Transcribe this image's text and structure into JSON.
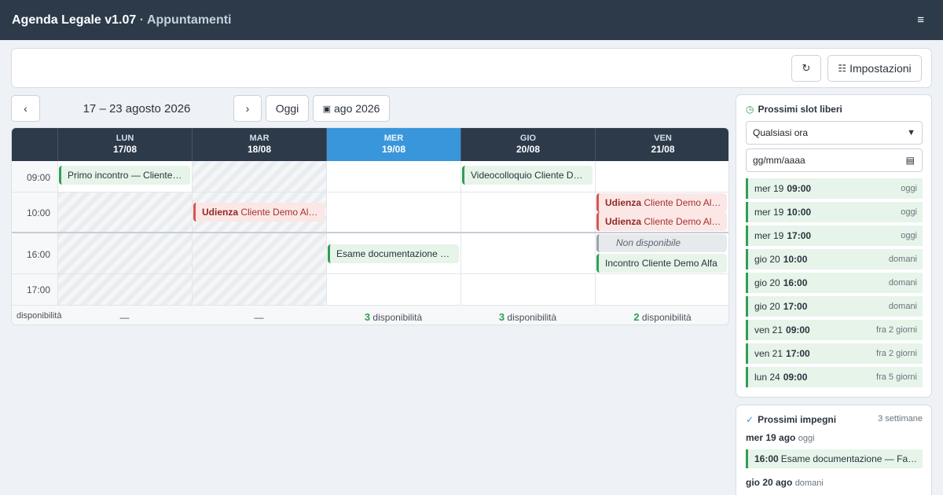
{
  "header": {
    "app_title": "Agenda Legale v1.07",
    "separator": "·",
    "section": "Appuntamenti",
    "menu_icon": "≡"
  },
  "toolbar": {
    "refresh_icon": "↻",
    "settings_icon": "☷",
    "settings_label": "Impostazioni"
  },
  "week_nav": {
    "prev": "‹",
    "range": "17 – 23 agosto 2026",
    "next": "›",
    "today": "Oggi",
    "month_icon": "▣",
    "month": "ago 2026"
  },
  "calendar": {
    "days": [
      {
        "name": "LUN",
        "date": "17/08"
      },
      {
        "name": "MAR",
        "date": "18/08"
      },
      {
        "name": "MER",
        "date": "19/08"
      },
      {
        "name": "GIO",
        "date": "20/08"
      },
      {
        "name": "VEN",
        "date": "21/08"
      }
    ],
    "today_index": 2,
    "times": [
      "09:00",
      "10:00",
      "16:00",
      "17:00"
    ],
    "events": [
      {
        "text": "Primo incontro — Cliente…",
        "type": "green"
      },
      {
        "text": "Videocolloquio Cliente D…",
        "type": "green"
      },
      {
        "strong": "Udienza",
        "text": " Cliente Demo Al…",
        "type": "red"
      },
      {
        "strong": "Udienza",
        "text": " Cliente Demo Al…",
        "type": "red"
      },
      {
        "strong": "Udienza",
        "text": " Cliente Demo Al…",
        "type": "red"
      },
      {
        "text": "Non disponibile",
        "type": "gray"
      },
      {
        "text": "Esame documentazione …",
        "type": "green"
      },
      {
        "text": "Incontro Cliente Demo Alfa",
        "type": "green"
      }
    ],
    "availability_label": "disponibilità",
    "availability": [
      {
        "count": "",
        "text": "—"
      },
      {
        "count": "",
        "text": "—"
      },
      {
        "count": "3",
        "text": " disponibilità"
      },
      {
        "count": "3",
        "text": " disponibilità"
      },
      {
        "count": "2",
        "text": " disponibilità"
      }
    ]
  },
  "free_slots": {
    "icon": "◷",
    "title": "Prossimi slot liberi",
    "select_value": "Qualsiasi ora",
    "date_placeholder": "gg/mm/aaaa",
    "slots": [
      {
        "day": "mer 19",
        "time": "09:00",
        "rel": "oggi"
      },
      {
        "day": "mer 19",
        "time": "10:00",
        "rel": "oggi"
      },
      {
        "day": "mer 19",
        "time": "17:00",
        "rel": "oggi"
      },
      {
        "day": "gio 20",
        "time": "10:00",
        "rel": "domani"
      },
      {
        "day": "gio 20",
        "time": "16:00",
        "rel": "domani"
      },
      {
        "day": "gio 20",
        "time": "17:00",
        "rel": "domani"
      },
      {
        "day": "ven 21",
        "time": "09:00",
        "rel": "fra 2 giorni"
      },
      {
        "day": "ven 21",
        "time": "17:00",
        "rel": "fra 2 giorni"
      },
      {
        "day": "lun 24",
        "time": "09:00",
        "rel": "fra 5 giorni"
      }
    ]
  },
  "upcoming": {
    "icon": "✓",
    "title": "Prossimi impegni",
    "range": "3 settimane",
    "groups": [
      {
        "day": "mer 19 ago",
        "rel": "oggi",
        "time": "16:00",
        "text": "Esame documentazione — Fa…"
      },
      {
        "day": "gio 20 ago",
        "rel": "domani"
      }
    ]
  },
  "colors": {
    "header_bg": "#2c3a4a",
    "today_bg": "#3a96db",
    "accent_green": "#2f9e55",
    "accent_red": "#d9534f"
  }
}
